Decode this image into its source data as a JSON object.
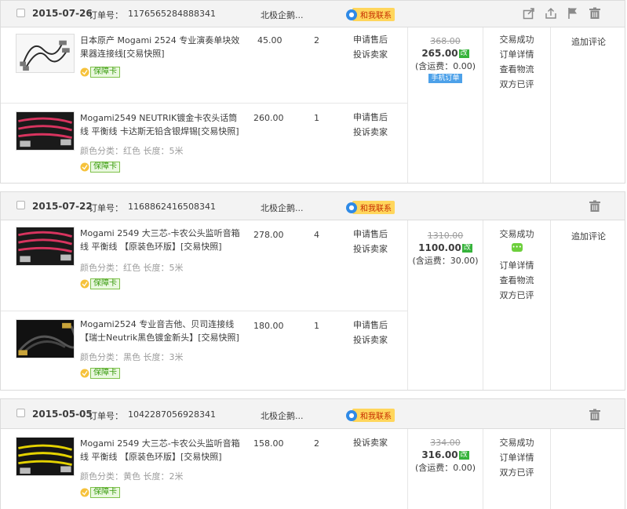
{
  "orders": [
    {
      "date": "2015-07-26",
      "order_label": "订单号：",
      "order_no": "1176565284888341",
      "seller": "北极企鹅...",
      "contact": "和我联系",
      "icons": [
        "share-icon",
        "upload-icon",
        "flag-icon",
        "trash-icon"
      ],
      "items": [
        {
          "title": "日本原产 Mogami 2524 专业演奏单块效果器连接线[交易快照]",
          "sku": "",
          "badge": "保障卡",
          "price": "45.00",
          "qty": "2",
          "actions": [
            "申请售后",
            "投诉卖家"
          ]
        },
        {
          "title": "Mogami2549 NEUTRIK镀金卡农头话筒线 平衡线 卡达斯无铅含银焊锡[交易快照]",
          "sku": "颜色分类：红色  长度：5米",
          "badge": "保障卡",
          "price": "260.00",
          "qty": "1",
          "actions": [
            "申请售后",
            "投诉卖家"
          ]
        }
      ],
      "orig_total": "368.00",
      "total": "265.00",
      "modified": "改",
      "shipping": "(含运费：0.00)",
      "mobile_tag": "手机订单",
      "status": [
        "交易成功",
        "订单详情",
        "查看物流",
        "双方已评"
      ],
      "review": "追加评论"
    },
    {
      "date": "2015-07-22",
      "order_label": "订单号：",
      "order_no": "1168862416508341",
      "seller": "北极企鹅...",
      "contact": "和我联系",
      "icons": [
        "trash-icon"
      ],
      "items": [
        {
          "title": "Mogami 2549 大三芯-卡农公头监听音箱线 平衡线 【原装色环版】[交易快照]",
          "sku": "颜色分类：红色  长度：5米",
          "badge": "保障卡",
          "price": "278.00",
          "qty": "4",
          "actions": [
            "申请售后",
            "投诉卖家"
          ]
        },
        {
          "title": "Mogami2524 专业音吉他、贝司连接线 【瑞士Neutrik黑色镀金新头】[交易快照]",
          "sku": "颜色分类：黑色  长度：3米",
          "badge": "保障卡",
          "price": "180.00",
          "qty": "1",
          "actions": [
            "申请售后",
            "投诉卖家"
          ]
        }
      ],
      "orig_total": "1310.00",
      "total": "1100.00",
      "modified": "改",
      "shipping": "(含运费：30.00)",
      "status": [
        "交易成功",
        "订单详情",
        "查看物流",
        "双方已评"
      ],
      "review": "追加评论"
    },
    {
      "date": "2015-05-05",
      "order_label": "订单号：",
      "order_no": "1042287056928341",
      "seller": "北极企鹅...",
      "contact": "和我联系",
      "icons": [
        "trash-icon"
      ],
      "items": [
        {
          "title": "Mogami 2549 大三芯-卡农公头监听音箱线 平衡线 【原装色环版】[交易快照]",
          "sku": "颜色分类：黄色  长度：2米",
          "badge": "保障卡",
          "price": "158.00",
          "qty": "2",
          "actions": [
            "投诉卖家"
          ]
        }
      ],
      "orig_total": "334.00",
      "total": "316.00",
      "modified": "改",
      "shipping": "(含运费：0.00)",
      "status": [
        "交易成功",
        "订单详情",
        "双方已评"
      ],
      "review": ""
    }
  ],
  "colors": {
    "header_bg": "#f3f3f3",
    "border": "#dcdcdc",
    "contact_bg": "#ffd65c",
    "badge_green": "#3a9b0f",
    "modified_green": "#36b33b",
    "mobile_blue": "#4da1e9",
    "cable_red": "#d8345f",
    "cable_black": "#2a2a2a",
    "cable_yellow": "#e4d200"
  }
}
